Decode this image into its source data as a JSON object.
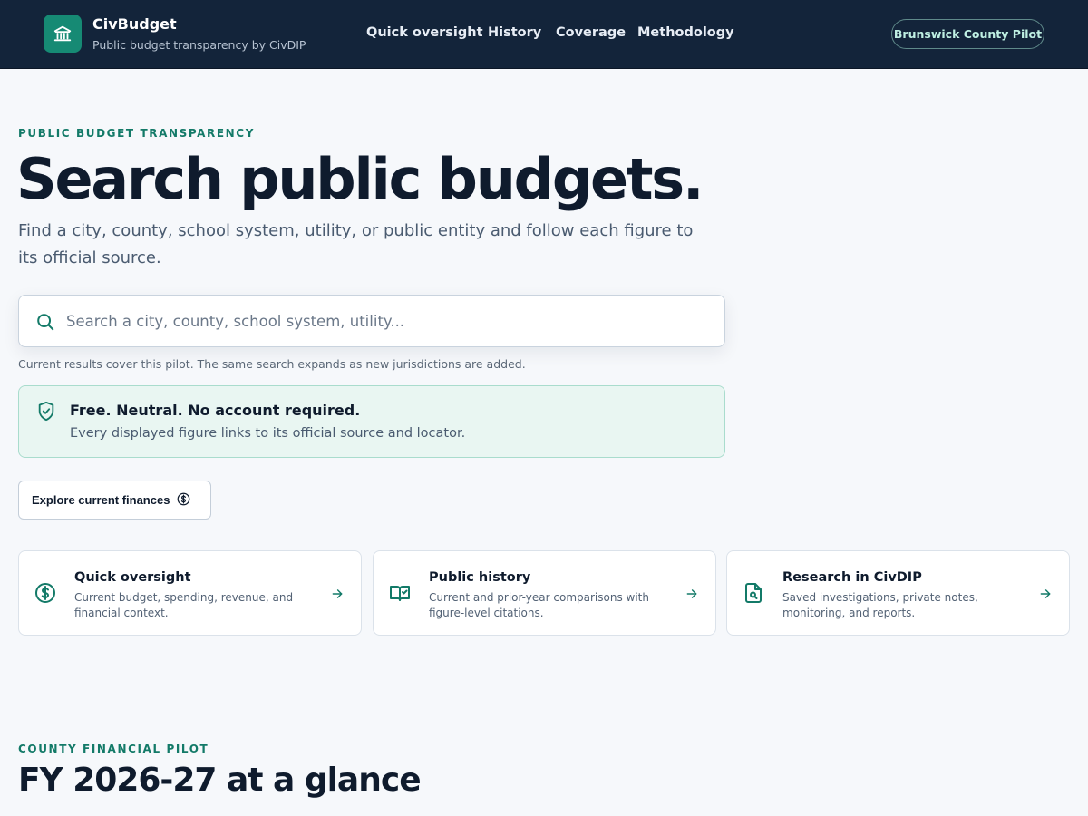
{
  "header": {
    "brand_name": "CivBudget",
    "brand_tagline": "Public budget transparency by CivDIP",
    "nav": [
      "Quick oversight",
      "History",
      "Coverage",
      "Methodology"
    ],
    "pilot_label": "Brunswick County Pilot"
  },
  "hero": {
    "eyebrow": "PUBLIC BUDGET TRANSPARENCY",
    "title": "Search public budgets.",
    "subtitle": "Find a city, county, school system, utility, or public entity and follow each figure to its official source.",
    "search": {
      "placeholder": "Search a city, county, school system, utility...",
      "value": ""
    },
    "search_note": "Current results cover this pilot. The same search expands as new jurisdictions are added.",
    "notice": {
      "title": "Free. Neutral. No account required.",
      "body": "Every displayed figure links to its official source and locator."
    },
    "explore_label": "Explore current finances"
  },
  "cards": [
    {
      "title": "Quick oversight",
      "desc": "Current budget, spending, revenue, and financial context.",
      "icon": "dollar-circle-icon"
    },
    {
      "title": "Public history",
      "desc": "Current and prior-year comparisons with figure-level citations.",
      "icon": "book-check-icon"
    },
    {
      "title": "Research in CivDIP",
      "desc": "Saved investigations, private notes, monitoring, and reports.",
      "icon": "file-search-icon"
    }
  ],
  "pilot_section": {
    "eyebrow": "COUNTY FINANCIAL PILOT",
    "title": "FY 2026-27 at a glance"
  },
  "colors": {
    "header_bg": "#13243a",
    "accent": "#137a68",
    "page_bg": "#f6f8fb"
  }
}
